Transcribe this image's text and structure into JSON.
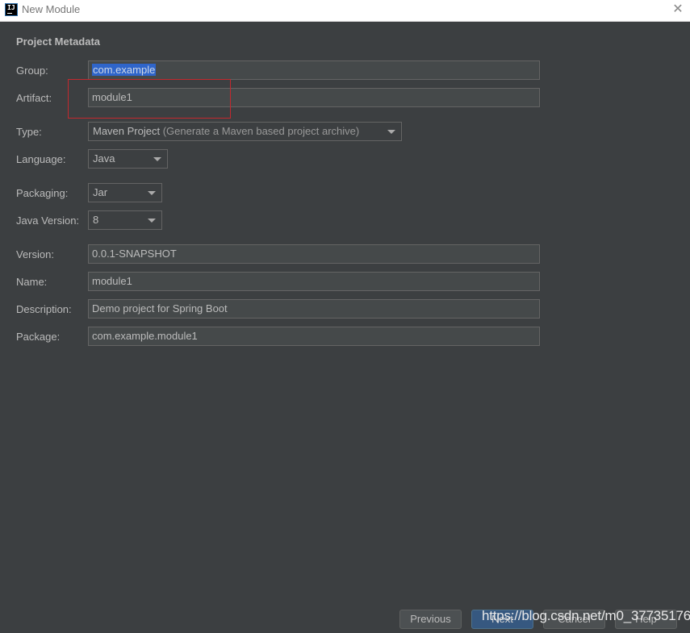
{
  "window": {
    "title": "New Module",
    "app_icon": "intellij-icon",
    "close_icon": "close-icon"
  },
  "section": {
    "title": "Project Metadata"
  },
  "fields": {
    "group": {
      "label": "Group:",
      "value": "com.example",
      "selected": true
    },
    "artifact": {
      "label": "Artifact:",
      "value": "module1"
    },
    "type": {
      "label": "Type:",
      "value": "Maven Project",
      "hint": "(Generate a Maven based project archive)"
    },
    "language": {
      "label": "Language:",
      "value": "Java"
    },
    "packaging": {
      "label": "Packaging:",
      "value": "Jar"
    },
    "java_version": {
      "label": "Java Version:",
      "value": "8"
    },
    "version": {
      "label": "Version:",
      "value": "0.0.1-SNAPSHOT"
    },
    "name": {
      "label": "Name:",
      "value": "module1"
    },
    "description": {
      "label": "Description:",
      "value": "Demo project for Spring Boot"
    },
    "package": {
      "label": "Package:",
      "value": "com.example.module1"
    }
  },
  "annotation": {
    "highlight_color": "#c4282e",
    "target": "artifact"
  },
  "buttons": {
    "previous": "Previous",
    "next": "Next",
    "cancel": "Cancel",
    "help": "Help"
  },
  "watermark": "https://blog.csdn.net/m0_37735176",
  "colors": {
    "background": "#3c3f41",
    "field_bg": "#45494a",
    "selection": "#2f65ca",
    "primary_button": "#365880"
  }
}
